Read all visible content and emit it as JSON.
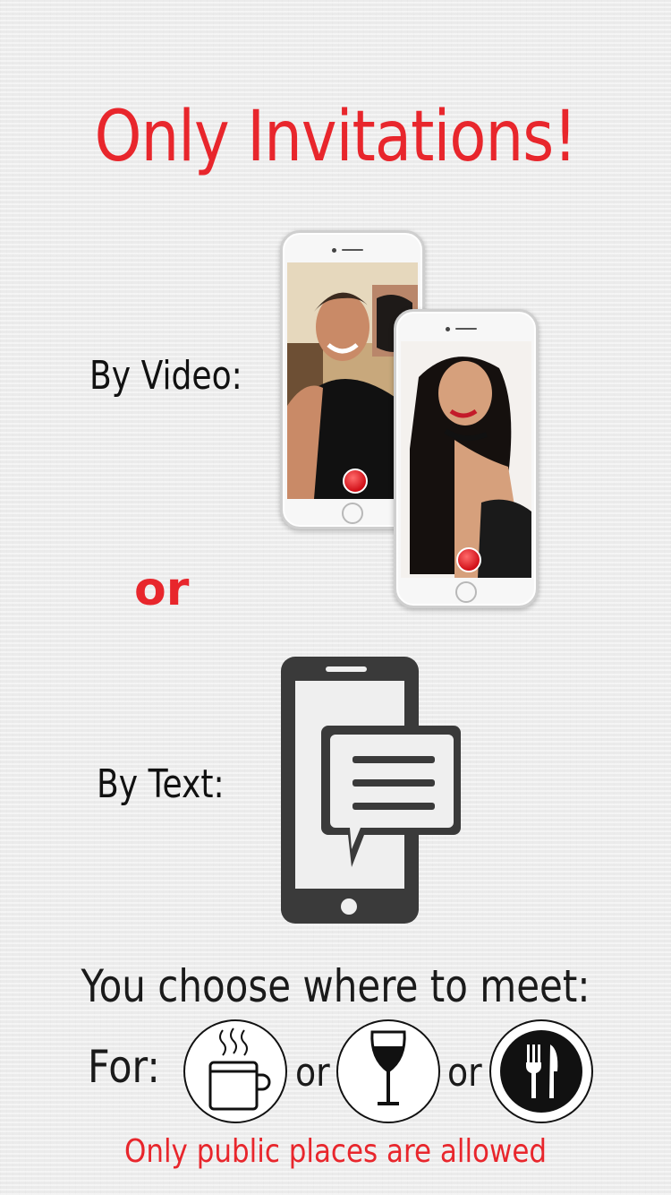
{
  "title": "Only Invitations!",
  "video": {
    "label": "By Video:",
    "icons": [
      "phone-video-call-man",
      "phone-video-call-woman",
      "record-button-icon"
    ]
  },
  "or_between": "or",
  "text": {
    "label": "By Text:",
    "icon": "phone-message-icon"
  },
  "meet": {
    "heading": "You choose where to meet:",
    "for_label": "For:",
    "options": [
      {
        "icon": "coffee-cup-icon"
      },
      {
        "icon": "wine-glass-icon"
      },
      {
        "icon": "fork-knife-icon"
      }
    ],
    "separator": "or"
  },
  "footer": "Only public places are allowed",
  "colors": {
    "accent_red": "#e8262c",
    "text_dark": "#1a1a1a",
    "icon_gray": "#3a3a3a",
    "background": "#efefef"
  }
}
